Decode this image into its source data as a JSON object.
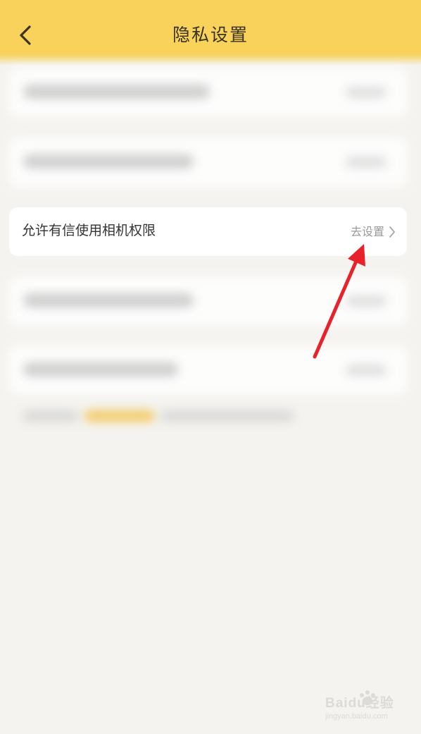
{
  "header": {
    "title": "隐私设置",
    "back_icon": "chevron-left-icon"
  },
  "privacy_items": [
    {
      "label": "",
      "action": "",
      "blurred": true
    },
    {
      "label": "",
      "action": "",
      "blurred": true
    },
    {
      "label": "允许有信使用相机权限",
      "action": "去设置",
      "blurred": false
    },
    {
      "label": "",
      "action": "",
      "blurred": true
    },
    {
      "label": "",
      "action": "",
      "blurred": true
    }
  ],
  "camera_item": {
    "label": "允许有信使用相机权限",
    "action_label": "去设置",
    "action_icon": "chevron-right-icon"
  },
  "annotation": {
    "icon": "red-arrow-icon",
    "color": "#e8222a"
  },
  "watermark": {
    "brand": "Baidu经验",
    "url": "jingyan.baidu.com"
  },
  "colors": {
    "header_bg": "#f8d25a",
    "page_bg": "#f4f3ef",
    "card_bg": "#ffffff",
    "accent_link": "#f5c445"
  }
}
